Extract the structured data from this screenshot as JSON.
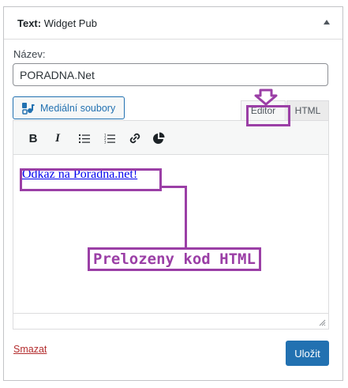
{
  "widget": {
    "title_prefix": "Text:",
    "title_name": " Widget Pub",
    "toggle_icon": "triangle-up-icon"
  },
  "form": {
    "name_label": "Název:",
    "name_value": "PORADNA.Net"
  },
  "editor": {
    "media_button_label": "Mediální soubory",
    "tabs": [
      {
        "label": "Editor",
        "active": true
      },
      {
        "label": "HTML",
        "active": false
      }
    ],
    "toolbar": [
      {
        "name": "bold",
        "glyph": "B"
      },
      {
        "name": "italic",
        "glyph": "I"
      },
      {
        "name": "bullet-list",
        "glyph": ""
      },
      {
        "name": "numbered-list",
        "glyph": ""
      },
      {
        "name": "link",
        "glyph": ""
      },
      {
        "name": "more",
        "glyph": ""
      }
    ],
    "content_link_text": "Odkaz na Poradna.net!"
  },
  "footer": {
    "delete_label": "Smazat",
    "save_label": "Uložit"
  },
  "annotation": {
    "label": "Prelozeny kod HTML",
    "color": "#9b3fa6"
  },
  "colors": {
    "accent": "#2271b1",
    "delete": "#b32d2e",
    "annotation": "#9b3fa6"
  }
}
